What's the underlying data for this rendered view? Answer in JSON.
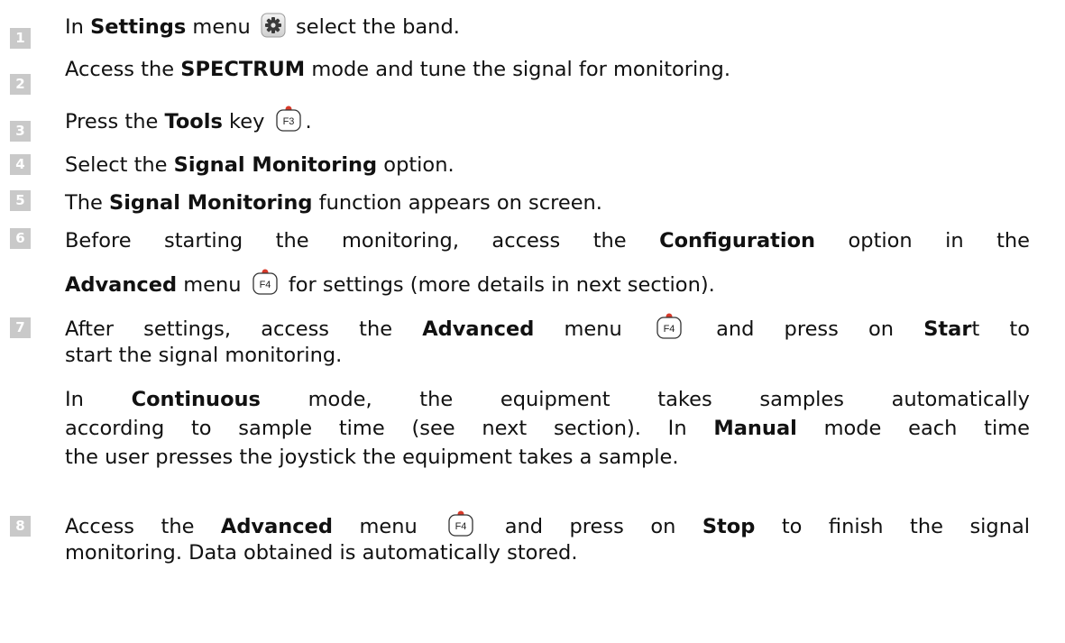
{
  "colors": {
    "badge": "#c9c9c9",
    "key_dot": "#d83a2a"
  },
  "steps": [
    {
      "num": "1",
      "pre": "In ",
      "b1": "Settings",
      "mid": " menu ",
      "icon": "gear-icon",
      "post": " select the band."
    },
    {
      "num": "2",
      "pre": "Access the ",
      "b1": "SPECTRUM",
      "post": " mode and tune the signal for monitoring."
    },
    {
      "num": "3",
      "pre": "Press the ",
      "b1": "Tools",
      "mid": " key ",
      "key": "F3",
      "post": "."
    },
    {
      "num": "4",
      "pre": "Select the ",
      "b1": "Signal Monitoring",
      "post": " option."
    },
    {
      "num": "5",
      "pre": "The ",
      "b1": "Signal Monitoring",
      "post": " function appears on screen."
    },
    {
      "num": "6",
      "l1_pre": "Before starting the monitoring, access the ",
      "l1_b": "Configuration",
      "l1_post": " option in the",
      "l2_b": "Advanced",
      "l2_mid": " menu ",
      "key": "F4",
      "l2_post": " for settings (more details in next section)."
    },
    {
      "num": "7",
      "l1_pre": "After settings, access the ",
      "l1_b": "Advanced",
      "l1_mid": " menu ",
      "key": "F4",
      "l1_mid2": " and press on ",
      "l1_b2": "Star",
      "l1_post": "t to",
      "l2": "start the signal monitoring.",
      "p1_pre": "In ",
      "p1_b": "Continuous",
      "p1_post": " mode, the equipment takes samples automatically",
      "p2_pre": "according to sample time (see next section). In ",
      "p2_b": "Manual",
      "p2_post": " mode each time",
      "p3": "the user presses the joystick the equipment takes a sample."
    },
    {
      "num": "8",
      "l1_pre": "Access the ",
      "l1_b": "Advanced",
      "l1_mid": " menu ",
      "key": "F4",
      "l1_mid2": " and press on ",
      "l1_b2": "Stop",
      "l1_post": " to finish the signal",
      "l2": "monitoring. Data obtained is automatically stored."
    }
  ]
}
